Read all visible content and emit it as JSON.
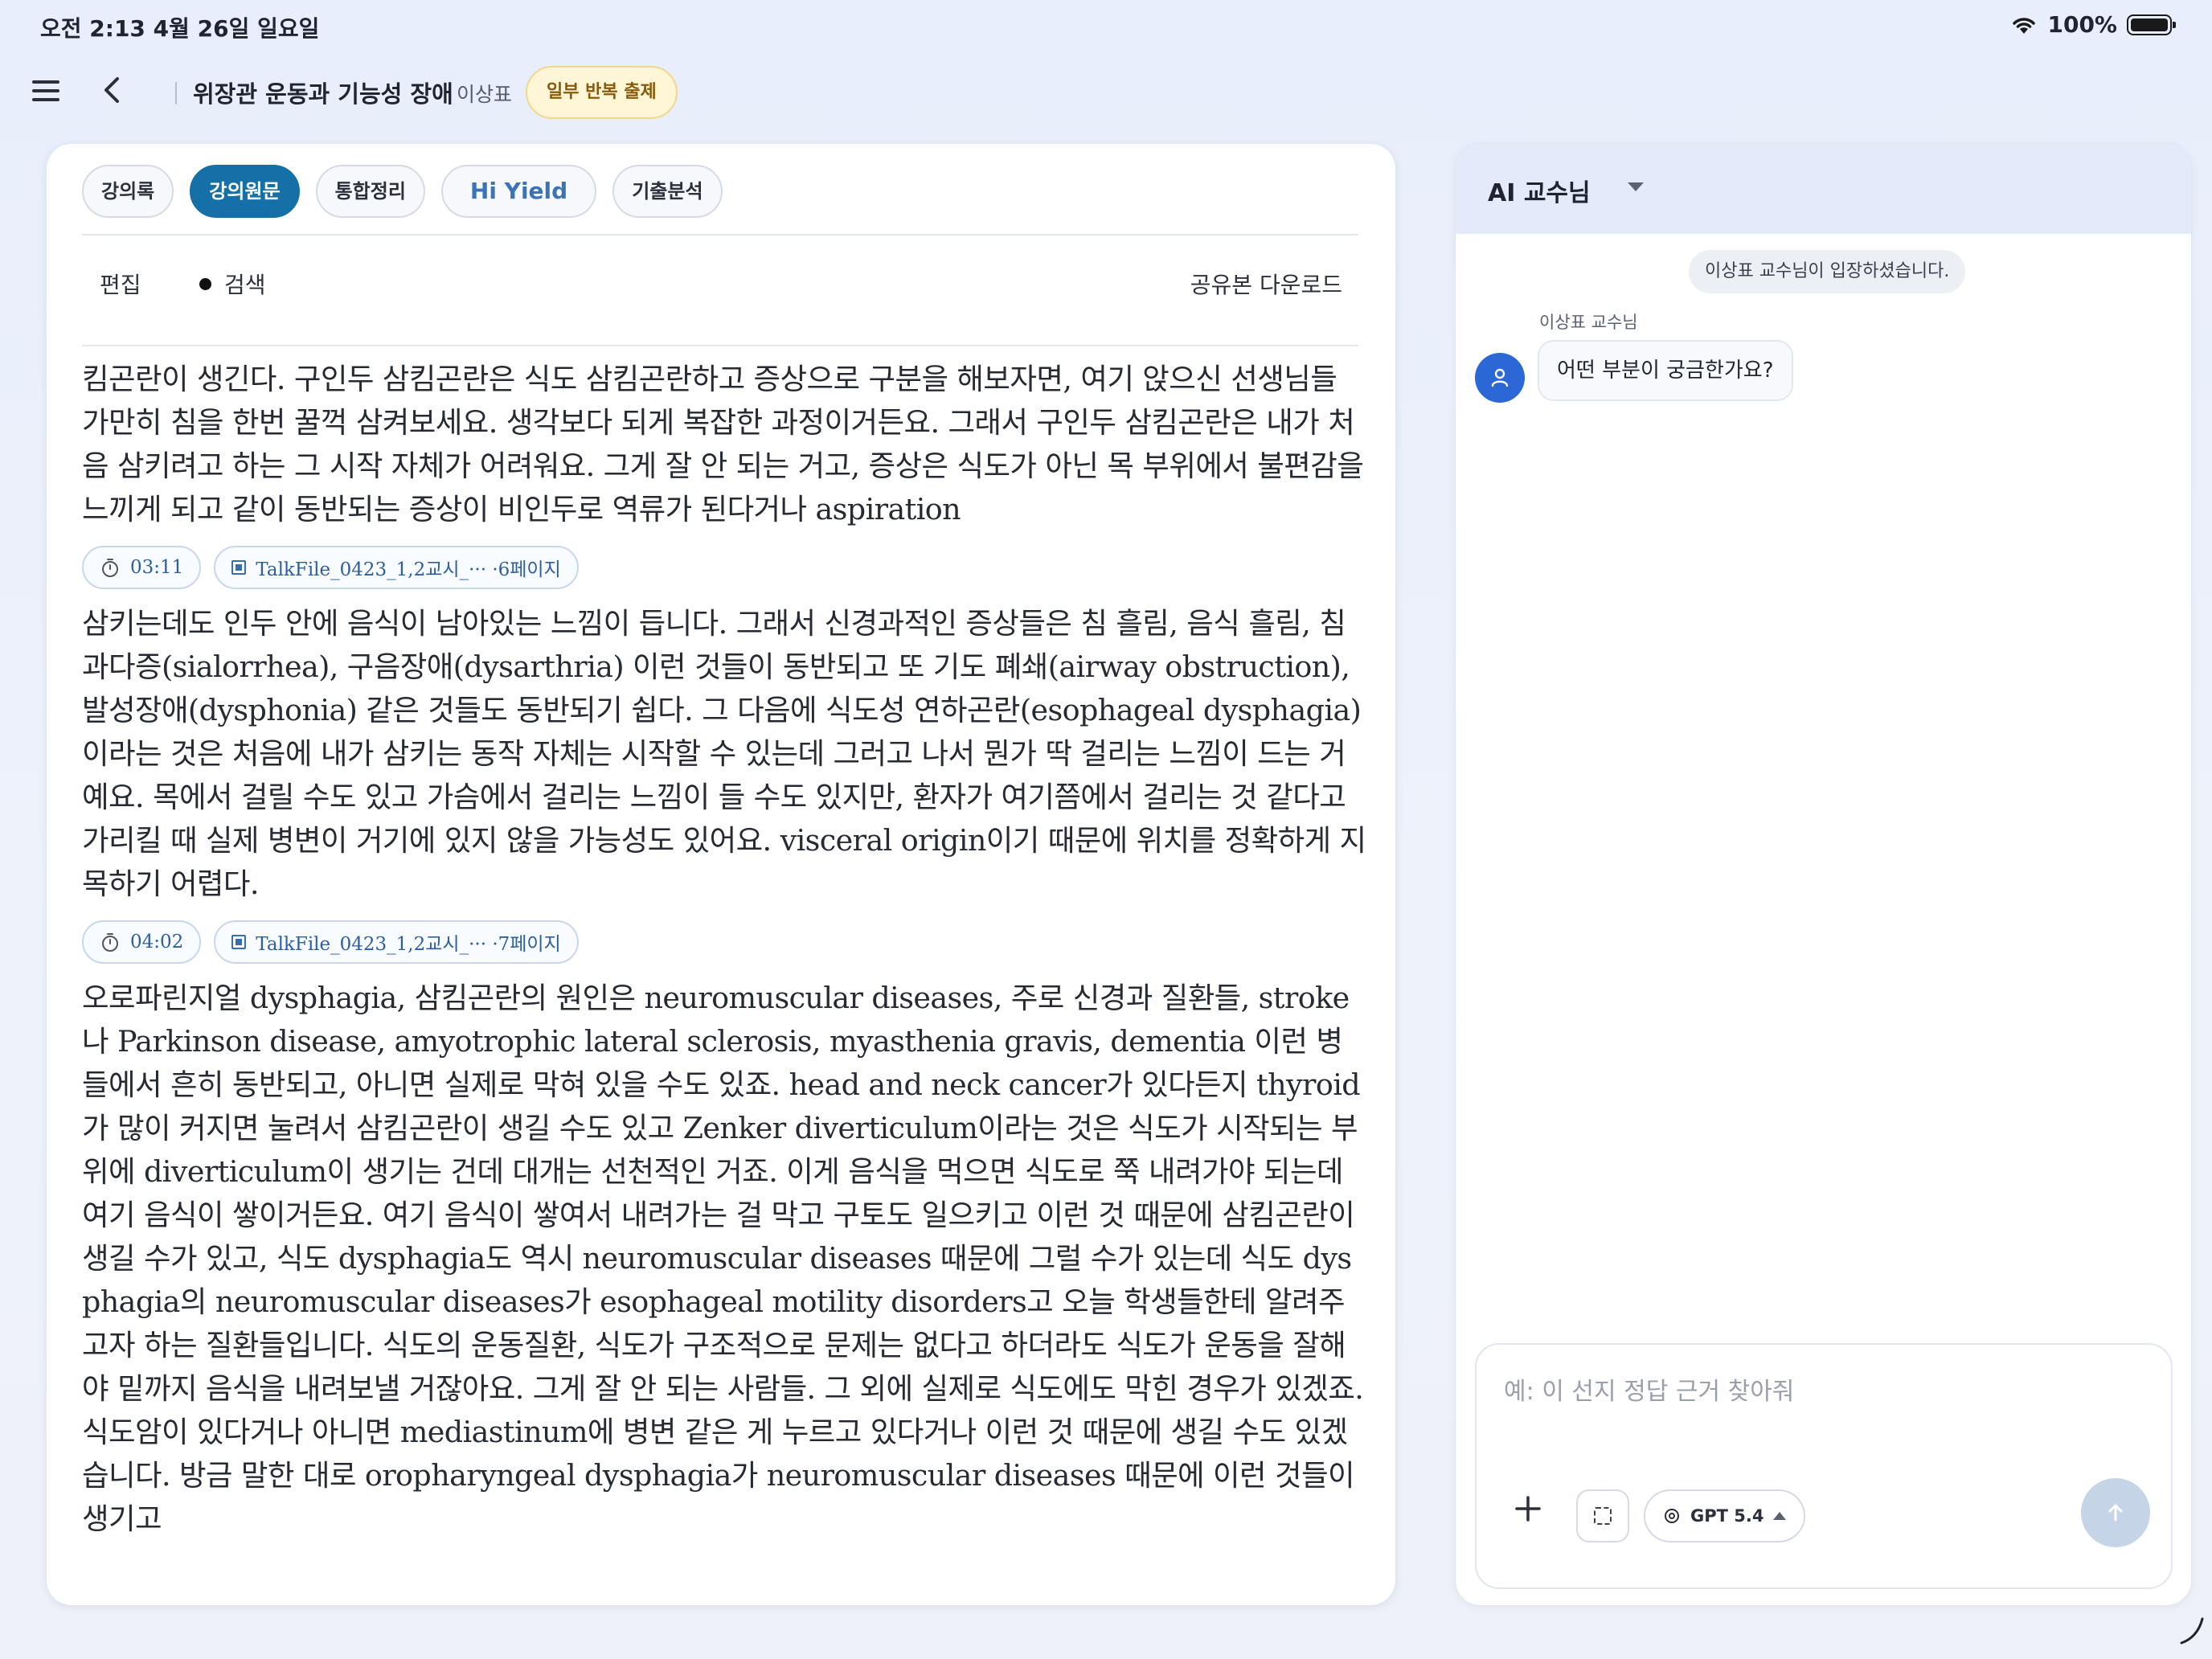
{
  "status_bar": {
    "time": "오전 2:13   4월 26일 일요일",
    "battery": "100%"
  },
  "header": {
    "title": "위장관 운동과 기능성 장애",
    "professor": "이상표",
    "badge": "일부 반복 출제"
  },
  "tabs": [
    {
      "label": "강의록",
      "active": false
    },
    {
      "label": "강의원문",
      "active": true
    },
    {
      "label": "통합정리",
      "active": false
    },
    {
      "label": "Hi Yield",
      "active": false
    },
    {
      "label": "기출분석",
      "active": false
    }
  ],
  "toolbar": {
    "edit": "편집",
    "search": "검색",
    "download": "공유본 다운로드"
  },
  "transcript": [
    {
      "text": "킴곤란이 생긴다. 구인두 삼킴곤란은 식도 삼킴곤란하고 증상으로 구분을 해보자면, 여기 앉으신 선생님들 가만히 침을 한번 꿀꺽 삼켜보세요. 생각보다 되게 복잡한 과정이거든요. 그래서 구인두 삼킴곤란은 내가 처음 삼키려고 하는 그 시작 자체가 어려워요. 그게 잘 안 되는 거고, 증상은 식도가 아닌 목 부위에서 불편감을 느끼게 되고 같이 동반되는 증상이 비인두로 역류가 된다거나 aspiration",
      "time": "03:11",
      "file": "TalkFile_0423_1,2교시_··· ·6페이지"
    },
    {
      "text": "삼키는데도 인두 안에 음식이 남아있는 느낌이 듭니다. 그래서 신경과적인 증상들은 침 흘림, 음식 흘림, 침과다증(sialorrhea), 구음장애(dysarthria) 이런 것들이 동반되고 또 기도 폐쇄(airway obstruction), 발성장애(dysphonia) 같은 것들도 동반되기 쉽다. 그 다음에 식도성 연하곤란(esophageal dysphagia)이라는 것은 처음에 내가 삼키는 동작 자체는 시작할 수 있는데 그러고 나서 뭔가 딱 걸리는 느낌이 드는 거예요. 목에서 걸릴 수도 있고 가슴에서 걸리는 느낌이 들 수도 있지만, 환자가 여기쯤에서 걸리는 것 같다고 가리킬 때 실제 병변이 거기에 있지 않을 가능성도 있어요. visceral origin이기 때문에 위치를 정확하게 지목하기 어렵다.",
      "time": "04:02",
      "file": "TalkFile_0423_1,2교시_··· ·7페이지"
    },
    {
      "text": "오로파린지얼 dysphagia, 삼킴곤란의 원인은 neuromuscular diseases, 주로 신경과 질환들, stroke나 Parkinson disease, amyotrophic lateral sclerosis, myasthenia gravis, dementia 이런 병들에서 흔히 동반되고, 아니면 실제로 막혀 있을 수도 있죠. head and neck cancer가 있다든지 thyroid가 많이 커지면 눌려서 삼킴곤란이 생길 수도 있고 Zenker diverticulum이라는 것은 식도가 시작되는 부위에 diverticulum이 생기는 건데 대개는 선천적인 거죠. 이게 음식을 먹으면 식도로 쭉 내려가야 되는데 여기 음식이 쌓이거든요. 여기 음식이 쌓여서 내려가는 걸 막고 구토도 일으키고 이런 것 때문에 삼킴곤란이 생길 수가 있고, 식도 dysphagia도 역시 neuromuscular diseases 때문에 그럴 수가 있는데 식도 dysphagia의 neuromuscular diseases가 esophageal motility disorders고 오늘 학생들한테 알려주고자 하는 질환들입니다. 식도의 운동질환, 식도가 구조적으로 문제는 없다고 하더라도 식도가 운동을 잘해야 밑까지 음식을 내려보낼 거잖아요. 그게 잘 안 되는 사람들. 그 외에 실제로 식도에도 막힌 경우가 있겠죠. 식도암이 있다거나 아니면 mediastinum에 병변 같은 게 누르고 있다거나 이런 것 때문에 생길 수도 있겠습니다. 방금 말한 대로 oropharyngeal dysphagia가 neuromuscular diseases 때문에 이런 것들이 생기고"
    }
  ],
  "chat": {
    "title": "AI 교수님",
    "system_message": "이상표 교수님이 입장하셨습니다.",
    "sender": "이상표 교수님",
    "message": "어떤 부분이 궁금한가요?",
    "input_placeholder": "예: 이 선지 정답 근거 찾아줘",
    "model": "GPT 5.4"
  },
  "colors": {
    "accent": "#1670a8",
    "badge_bg": "#fff6d8",
    "avatar": "#2b68d6"
  }
}
